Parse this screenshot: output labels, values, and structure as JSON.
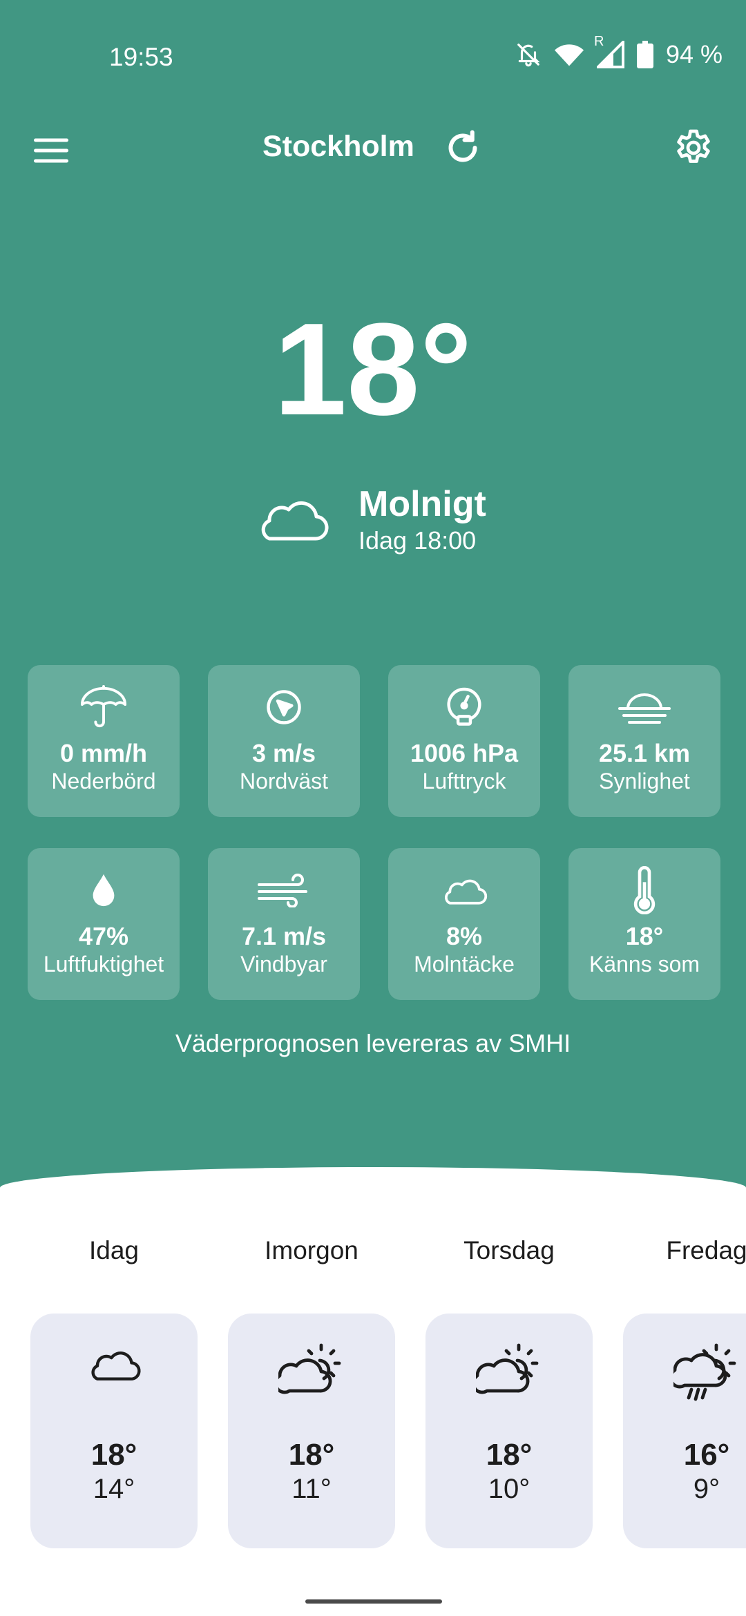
{
  "status_bar": {
    "time": "19:53",
    "battery_text": "94 %",
    "icons": [
      "bell-off-icon",
      "wifi-icon",
      "cell-signal-icon",
      "battery-icon"
    ],
    "roaming_label": "R"
  },
  "app_bar": {
    "city": "Stockholm",
    "icons": [
      "menu-icon",
      "refresh-icon",
      "settings-icon"
    ]
  },
  "current": {
    "temperature": "18°",
    "condition": "Molnigt",
    "time_label": "Idag 18:00",
    "icon": "cloud-icon"
  },
  "tiles": [
    {
      "icon": "umbrella-icon",
      "value": "0 mm/h",
      "label": "Nederbörd"
    },
    {
      "icon": "wind-direction-icon",
      "value": "3 m/s",
      "label": "Nordväst"
    },
    {
      "icon": "gauge-icon",
      "value": "1006 hPa",
      "label": "Lufttryck"
    },
    {
      "icon": "fog-icon",
      "value": "25.1 km",
      "label": "Synlighet"
    },
    {
      "icon": "droplet-icon",
      "value": "47%",
      "label": "Luftfuktighet"
    },
    {
      "icon": "wind-icon",
      "value": "7.1 m/s",
      "label": "Vindbyar"
    },
    {
      "icon": "cloud-icon",
      "value": "8%",
      "label": "Molntäcke"
    },
    {
      "icon": "thermometer-icon",
      "value": "18°",
      "label": "Känns som"
    }
  ],
  "credit": "Väderprognosen levereras av SMHI",
  "forecast": [
    {
      "day": "Idag",
      "icon": "cloud-icon",
      "high": "18°",
      "low": "14°"
    },
    {
      "day": "Imorgon",
      "icon": "partly-cloudy-icon",
      "high": "18°",
      "low": "11°"
    },
    {
      "day": "Torsdag",
      "icon": "partly-cloudy-icon",
      "high": "18°",
      "low": "10°"
    },
    {
      "day": "Fredag",
      "icon": "sun-cloud-rain-icon",
      "high": "16°",
      "low": "9°"
    }
  ],
  "colors": {
    "background": "#419783",
    "tile": "#67ad9d",
    "sheet": "#ffffff",
    "day_card": "#e8eaf4"
  }
}
